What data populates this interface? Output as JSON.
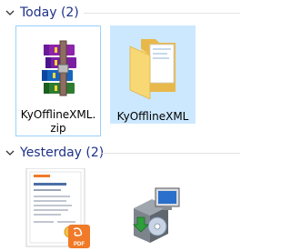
{
  "groups": [
    {
      "label": "Today (2)",
      "items": [
        {
          "name": "KyOfflineXML.zip",
          "icon": "winrar-archive-icon"
        },
        {
          "name": "KyOfflineXML",
          "icon": "folder-icon"
        }
      ]
    },
    {
      "label": "Yesterday (2)",
      "items": [
        {
          "name": "",
          "icon": "pdf-certificate-thumbnail"
        },
        {
          "name": "",
          "icon": "installer-icon"
        }
      ]
    }
  ],
  "pdf_badge": "PDF",
  "colors": {
    "header_text": "#1e3287",
    "focus_border": "#99d1ff",
    "selected_bg": "#cce8ff",
    "folder": "#f8d775",
    "pdf_badge": "#f07a28"
  }
}
